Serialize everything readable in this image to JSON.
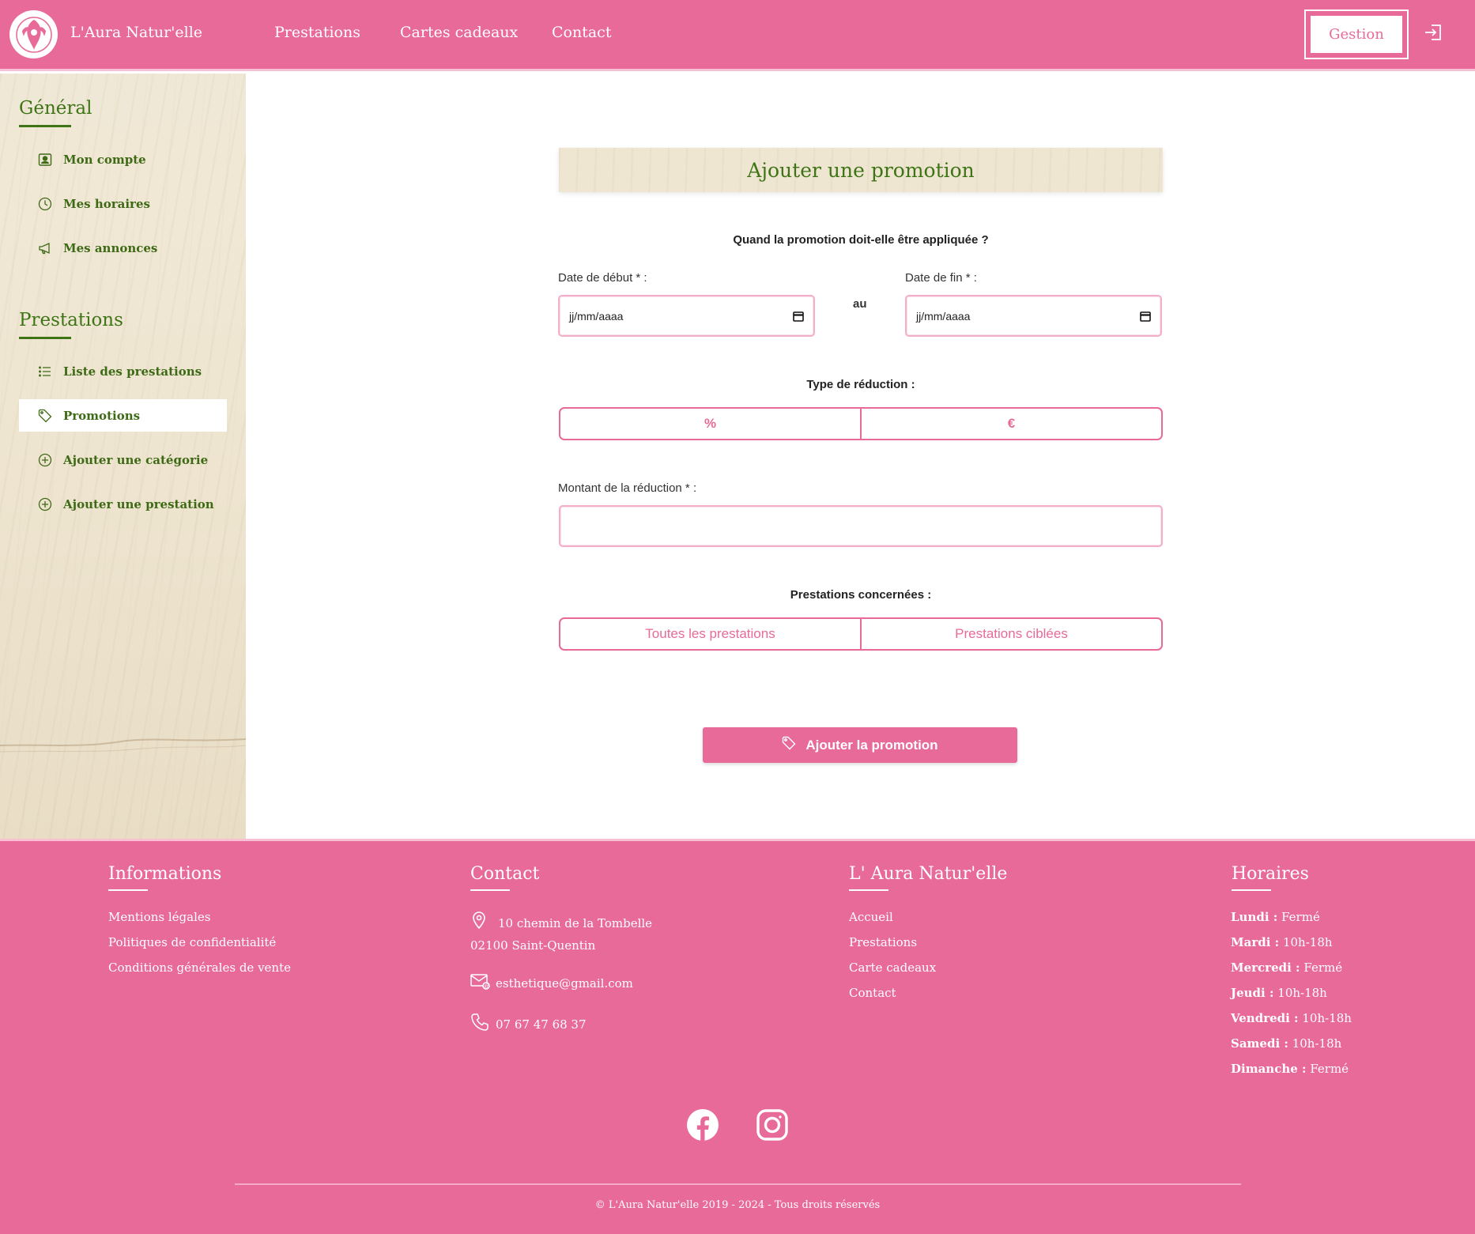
{
  "header": {
    "brand": "L'Aura Natur'elle",
    "nav": [
      "Prestations",
      "Cartes cadeaux",
      "Contact"
    ],
    "gestion_label": "Gestion",
    "logo_icon": "woman-face-logo-icon",
    "login_icon": "sign-in-icon"
  },
  "sidebar": {
    "sections": [
      {
        "title": "Général",
        "items": [
          {
            "label": "Mon compte",
            "icon": "user-card-icon"
          },
          {
            "label": "Mes horaires",
            "icon": "clock-icon"
          },
          {
            "label": "Mes annonces",
            "icon": "megaphone-icon"
          }
        ]
      },
      {
        "title": "Prestations",
        "items": [
          {
            "label": "Liste des prestations",
            "icon": "list-icon"
          },
          {
            "label": "Promotions",
            "icon": "tag-icon",
            "active": true
          },
          {
            "label": "Ajouter une catégorie",
            "icon": "plus-circle-icon"
          },
          {
            "label": "Ajouter une prestation",
            "icon": "plus-circle-icon"
          }
        ]
      }
    ]
  },
  "form": {
    "title": "Ajouter une promotion",
    "when_question": "Quand la promotion doit-elle être appliquée ?",
    "start_label": "Date de début * :",
    "start_placeholder": "jj/mm/aaaa",
    "separator": "au",
    "end_label": "Date de fin * :",
    "end_placeholder": "jj/mm/aaaa",
    "reduction_type_label": "Type de réduction :",
    "reduction_types": [
      "%",
      "€"
    ],
    "amount_label": "Montant de la réduction * :",
    "amount_value": "",
    "concerned_label": "Prestations concernées :",
    "concerned_options": [
      "Toutes les prestations",
      "Prestations ciblées"
    ],
    "submit_label": "Ajouter la promotion"
  },
  "footer": {
    "informations": {
      "title": "Informations",
      "links": [
        "Mentions légales",
        "Politiques de confidentialité",
        "Conditions générales de vente"
      ]
    },
    "contact": {
      "title": "Contact",
      "address_line1": "10 chemin de la Tombelle",
      "address_line2": "02100 Saint-Quentin",
      "email": "esthetique@gmail.com",
      "phone": "07 67 47 68 37"
    },
    "brand_col": {
      "title": "L' Aura Natur'elle",
      "links": [
        "Accueil",
        "Prestations",
        "Carte cadeaux",
        "Contact"
      ]
    },
    "horaires": {
      "title": "Horaires",
      "days": [
        {
          "day": "Lundi :",
          "hours": "Fermé"
        },
        {
          "day": "Mardi :",
          "hours": "10h-18h"
        },
        {
          "day": "Mercredi :",
          "hours": "Fermé"
        },
        {
          "day": "Jeudi :",
          "hours": "10h-18h"
        },
        {
          "day": "Vendredi :",
          "hours": "10h-18h"
        },
        {
          "day": "Samedi :",
          "hours": "10h-18h"
        },
        {
          "day": "Dimanche :",
          "hours": "Fermé"
        }
      ]
    },
    "social_icons": [
      "facebook-icon",
      "instagram-icon"
    ],
    "copyright": "© L'Aura Natur'elle 2019 - 2024 - Tous droits réservés"
  },
  "colors": {
    "primary_pink": "#e86a98",
    "green": "#3e7416"
  }
}
